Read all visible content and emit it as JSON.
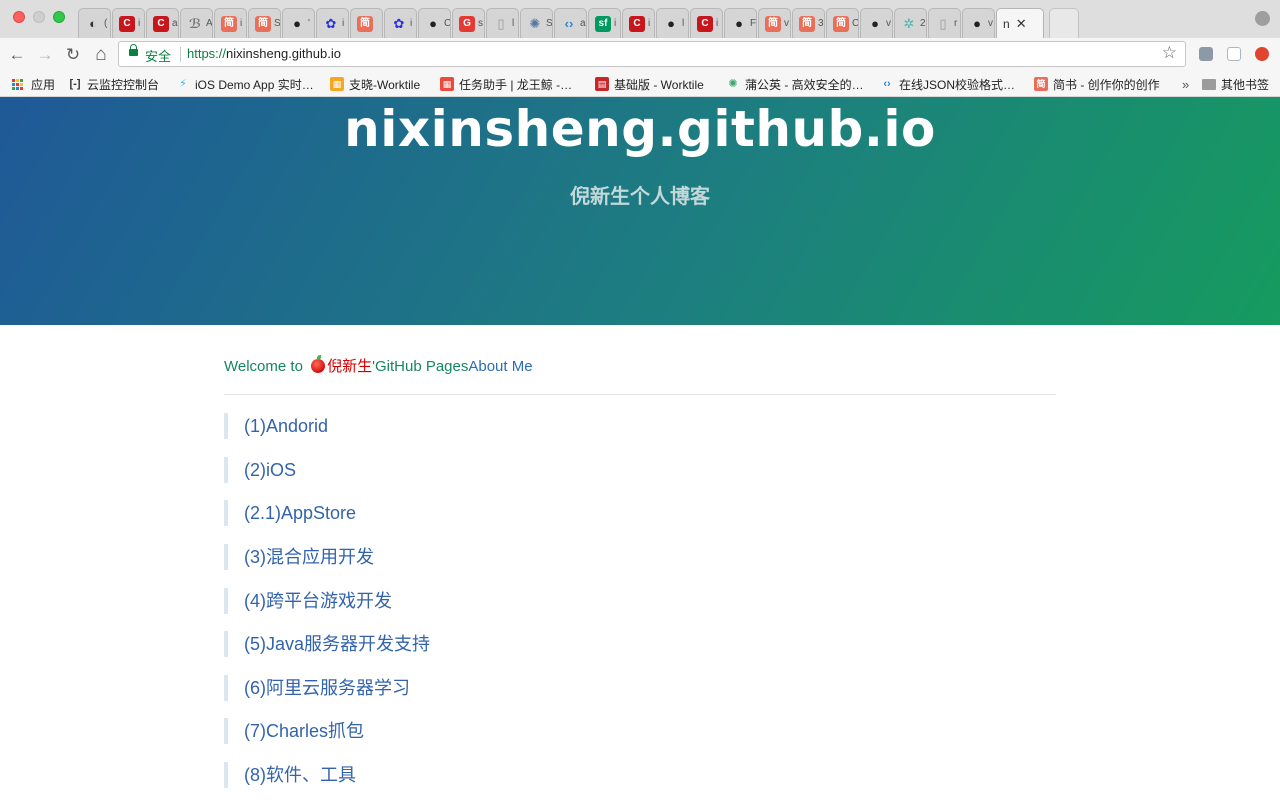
{
  "tabs": [
    {
      "icon": "penguin-icon",
      "color": "#333333",
      "glyph": "◐",
      "char": "("
    },
    {
      "icon": "csdn-icon",
      "color": "#c8161d",
      "glyph": "C",
      "char": "i"
    },
    {
      "icon": "csdn-icon",
      "color": "#c8161d",
      "glyph": "C",
      "char": "a"
    },
    {
      "icon": "script-icon",
      "color": "#777777",
      "glyph": "ℬ",
      "char": "A"
    },
    {
      "icon": "jianshu-icon",
      "color": "#ea6f5a",
      "glyph": "简",
      "char": "i"
    },
    {
      "icon": "jianshu-icon",
      "color": "#ea6f5a",
      "glyph": "简",
      "char": "S"
    },
    {
      "icon": "github-icon",
      "color": "#222222",
      "glyph": "●",
      "char": "'"
    },
    {
      "icon": "baidu-icon",
      "color": "#2932e1",
      "glyph": "✿",
      "char": "i"
    },
    {
      "icon": "jianshu-icon",
      "color": "#ea6f5a",
      "glyph": "简",
      "char": ""
    },
    {
      "icon": "baidu-icon",
      "color": "#2932e1",
      "glyph": "✿",
      "char": "i"
    },
    {
      "icon": "github-icon",
      "color": "#222222",
      "glyph": "●",
      "char": "C"
    },
    {
      "icon": "g-icon",
      "color": "#e53935",
      "glyph": "G",
      "char": "s"
    },
    {
      "icon": "document-icon",
      "color": "#999999",
      "glyph": "▯",
      "char": "l"
    },
    {
      "icon": "globe-icon",
      "color": "#5677a8",
      "glyph": "✺",
      "char": "S"
    },
    {
      "icon": "code-icon",
      "color": "#2b86d6",
      "glyph": "‹›",
      "char": "a"
    },
    {
      "icon": "segmentfault-icon",
      "color": "#009a61",
      "glyph": "sf",
      "char": "i"
    },
    {
      "icon": "csdn-icon",
      "color": "#c8161d",
      "glyph": "C",
      "char": "i"
    },
    {
      "icon": "github-icon",
      "color": "#222222",
      "glyph": "●",
      "char": "l"
    },
    {
      "icon": "csdn-icon",
      "color": "#c8161d",
      "glyph": "C",
      "char": "i"
    },
    {
      "icon": "github-icon",
      "color": "#222222",
      "glyph": "●",
      "char": "F"
    },
    {
      "icon": "jianshu-icon",
      "color": "#ea6f5a",
      "glyph": "简",
      "char": "v"
    },
    {
      "icon": "jianshu-icon",
      "color": "#ea6f5a",
      "glyph": "简",
      "char": "3"
    },
    {
      "icon": "jianshu-icon",
      "color": "#ea6f5a",
      "glyph": "简",
      "char": "C"
    },
    {
      "icon": "github-icon",
      "color": "#222222",
      "glyph": "●",
      "char": "v"
    },
    {
      "icon": "react-icon",
      "color": "#4db6ac",
      "glyph": "✲",
      "char": "2"
    },
    {
      "icon": "document-icon",
      "color": "#999999",
      "glyph": "▯",
      "char": "r"
    },
    {
      "icon": "github-icon",
      "color": "#222222",
      "glyph": "●",
      "char": "v"
    }
  ],
  "active_tab": {
    "label": "n",
    "close": "✕"
  },
  "toolbar": {
    "back": "←",
    "forward": "→",
    "reload": "↻",
    "home": "⌂",
    "secure_label": "安全",
    "url_scheme": "https://",
    "url_host": "nixinsheng.github.io",
    "star": "☆"
  },
  "bookmarks": [
    {
      "label": "应用",
      "icon": "apps-icon",
      "color": "#e53935"
    },
    {
      "label": "云监控控制台",
      "icon": "aliyun-icon",
      "color": "#333333",
      "glyph": "[-]"
    },
    {
      "label": "iOS Demo App 实时…",
      "icon": "lightning-icon",
      "color": "#35b8f0",
      "glyph": "⚡"
    },
    {
      "label": "支晓-Worktile",
      "icon": "worktile-icon",
      "color": "#f5a623",
      "glyph": "▦"
    },
    {
      "label": "任务助手 | 龙王鲸 -…",
      "icon": "worktile-icon",
      "color": "#e94b3c",
      "glyph": "▦"
    },
    {
      "label": "基础版 - Worktile",
      "icon": "worktile-red-icon",
      "color": "#c62828",
      "glyph": "▤"
    },
    {
      "label": "蒲公英 - 高效安全的…",
      "icon": "pgyer-icon",
      "color": "#3aa76d",
      "glyph": "✺"
    },
    {
      "label": "在线JSON校验格式…",
      "icon": "code-icon",
      "color": "#2b86d6",
      "glyph": "‹›"
    },
    {
      "label": "简书 - 创作你的创作",
      "icon": "jianshu-icon",
      "color": "#ea6f5a",
      "glyph": "简"
    }
  ],
  "bookmarks_overflow": "»",
  "other_bookmarks": "其他书签",
  "hero": {
    "title": "nixinsheng.github.io",
    "subtitle": "倪新生个人博客"
  },
  "welcome": {
    "prefix": "Welcome to ",
    "name": "倪新生",
    "link": "'GitHub Pages",
    "about": "About Me"
  },
  "items": [
    "(1)Andorid",
    "(2)iOS",
    "(2.1)AppStore",
    "(3)混合应用开发",
    "(4)跨平台游戏开发",
    "(5)Java服务器开发支持",
    "(6)阿里云服务器学习",
    "(7)Charles抓包",
    "(8)软件、工具"
  ]
}
